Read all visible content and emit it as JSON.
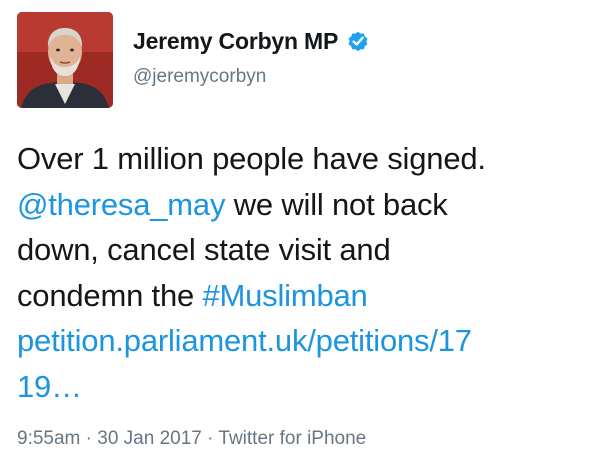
{
  "user": {
    "display_name": "Jeremy Corbyn MP",
    "handle": "@jeremycorbyn",
    "verified_icon": "verified-badge-icon",
    "avatar_icon": "profile-photo"
  },
  "tweet": {
    "line1": "Over 1 million people have signed.",
    "mention": "@theresa_may",
    "line2_rest": " we will not back",
    "line3": "down, cancel state visit and",
    "line4_pre": "condemn the ",
    "hashtag": "#Muslimban",
    "url_line1": "petition.parliament.uk/petitions/17",
    "url_line2": "19…"
  },
  "meta": {
    "time": "9:55am",
    "sep1": " · ",
    "date": "30 Jan 2017",
    "sep2": " · ",
    "source": "Twitter for iPhone"
  },
  "colors": {
    "link": "#1b95e0",
    "muted": "#657786",
    "text": "#14171a",
    "verified": "#1da1f2"
  }
}
